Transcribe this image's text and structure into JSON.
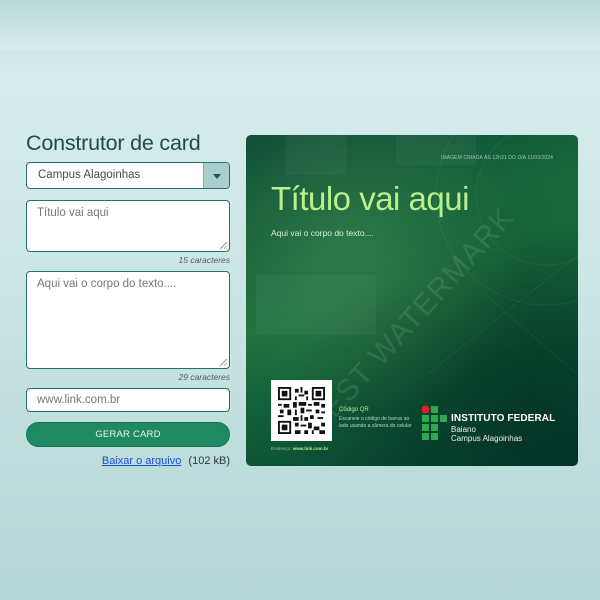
{
  "builder": {
    "title": "Construtor de card",
    "campus_select": {
      "value": "Campus Alagoinhas"
    },
    "title_field": {
      "placeholder": "Título vai aqui",
      "count": "15 caracteres"
    },
    "body_field": {
      "placeholder": "Aqui vai o corpo do texto....",
      "count": "29 caracteres"
    },
    "link_field": {
      "placeholder": "www.link.com.br"
    },
    "generate_label": "GERAR CARD",
    "download": {
      "link_label": "Baixar o arquivo",
      "size": "(102 kB)"
    }
  },
  "card": {
    "stamp": "IMAGEM CRIADA ÀS 12h31 DO DIA 11/03/2024",
    "title": "Título vai aqui",
    "body": "Aqui vai o corpo do texto....",
    "watermark": "TEST WATERMARK",
    "qr": {
      "label": "Código QR",
      "description": "Escaneie o código de barras ao lado usando a câmera do celular",
      "link_prefix": "Endereço:",
      "link": "www.link.com.br"
    },
    "institution": {
      "name": "INSTITUTO FEDERAL",
      "line2": "Baiano",
      "line3": "Campus Alagoinhas"
    }
  },
  "colors": {
    "accent": "#1f8a62",
    "card_title": "#b9ef8c",
    "logo_red": "#e02020",
    "logo_green": "#2fa84f"
  },
  "icons": {
    "select_arrow": "chevron-down-icon"
  }
}
